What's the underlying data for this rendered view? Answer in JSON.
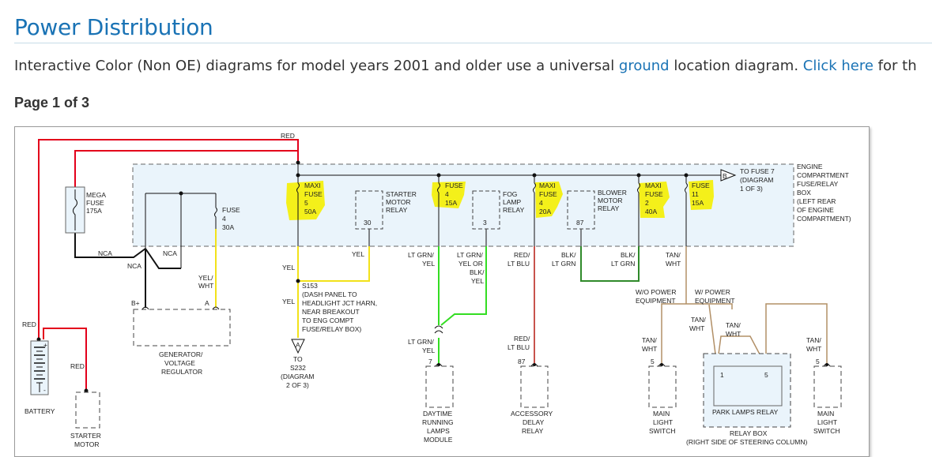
{
  "page": {
    "title": "Power Distribution",
    "intro_before": "Interactive Color (Non OE) diagrams for model years 2001 and older use a universal ",
    "intro_link_ground": "ground",
    "intro_middle": " location diagram. ",
    "intro_link_click": "Click here",
    "intro_after": " for th",
    "page_indicator": "Page 1 of 3"
  },
  "diagram": {
    "wire_labels": {
      "red_top": "RED",
      "red_battery": "RED",
      "red_starter": "RED",
      "nca1": "NCA",
      "nca2": "NCA",
      "nca3": "NCA",
      "yel_main": "YEL",
      "yel_relay": "YEL",
      "yel_splice": "YEL",
      "yel_wht": [
        "YEL/",
        "WHT"
      ],
      "lt_grn_yel": [
        "LT GRN/",
        "YEL"
      ],
      "lt_grn_yel_or": [
        "LT GRN/",
        "YEL OR",
        "BLK/",
        "YEL"
      ],
      "red_lt_blu": [
        "RED/",
        "LT BLU"
      ],
      "blk_lt_grn_1": [
        "BLK/",
        "LT GRN"
      ],
      "blk_lt_grn_2": [
        "BLK/",
        "LT GRN"
      ],
      "tan_wht_top": [
        "TAN/",
        "WHT"
      ],
      "lt_grn_yel_lower": [
        "LT GRN/",
        "YEL"
      ],
      "red_lt_blu_lower": [
        "RED/",
        "LT BLU"
      ],
      "tan_wht_switch_left": [
        "TAN/",
        "WHT"
      ],
      "tan_wht_relay_a": [
        "TAN/",
        "WHT"
      ],
      "tan_wht_relay_b": [
        "TAN/",
        "WHT"
      ],
      "tan_wht_switch_right": [
        "TAN/",
        "WHT"
      ]
    },
    "fuses": {
      "mega": [
        "MEGA",
        "FUSE",
        "175A"
      ],
      "fuse_4_30a": [
        "FUSE",
        "4",
        "30A"
      ],
      "maxi_5": [
        "MAXI",
        "FUSE",
        "5",
        "50A"
      ],
      "fuse_4_15a": [
        "FUSE",
        "4",
        "15A"
      ],
      "maxi_4": [
        "MAXI",
        "FUSE",
        "4",
        "20A"
      ],
      "maxi_2": [
        "MAXI",
        "FUSE",
        "2",
        "40A"
      ],
      "fuse_11": [
        "FUSE",
        "11",
        "15A"
      ]
    },
    "relays": {
      "starter": [
        "STARTER",
        "MOTOR",
        "RELAY"
      ],
      "fog": [
        "FOG",
        "LAMP",
        "RELAY"
      ],
      "blower": [
        "BLOWER",
        "MOTOR",
        "RELAY"
      ]
    },
    "pins": {
      "starter": "30",
      "fog": "3",
      "blower": "87",
      "b_plus": "B+",
      "gen_a": "A",
      "drl": "7",
      "acc": "87",
      "switch_left": "5",
      "relay_1": "1",
      "relay_5": "5",
      "switch_right": "5",
      "batt_plus": "+",
      "batt_minus": "-"
    },
    "connector_b": "B",
    "connector_a": "A",
    "to_fuse": [
      "TO FUSE 7",
      "(DIAGRAM",
      "1 OF 3)"
    ],
    "engine_box": [
      "ENGINE",
      "COMPARTMENT",
      "FUSE/RELAY",
      "BOX",
      "(LEFT REAR",
      "OF ENGINE",
      "COMPARTMENT)"
    ],
    "splice": [
      "S153",
      "(DASH PANEL TO",
      "HEADLIGHT JCT HARN,",
      "NEAR BREAKOUT",
      "TO ENG COMPT",
      "FUSE/RELAY BOX)"
    ],
    "to_s232": [
      "TO",
      "S232",
      "(DIAGRAM",
      "2 OF 3)"
    ],
    "equipment_wo": [
      "W/O POWER",
      "EQUIPMENT"
    ],
    "equipment_w": [
      "W/ POWER",
      "EQUIPMENT"
    ],
    "components": {
      "generator": [
        "GENERATOR/",
        "VOLTAGE",
        "REGULATOR"
      ],
      "battery": "BATTERY",
      "starter_motor": [
        "STARTER",
        "MOTOR"
      ],
      "drl": [
        "DAYTIME",
        "RUNNING",
        "LAMPS",
        "MODULE"
      ],
      "accessory": [
        "ACCESSORY",
        "DELAY",
        "RELAY"
      ],
      "main_switch_left": [
        "MAIN",
        "LIGHT",
        "SWITCH"
      ],
      "park_relay": "PARK LAMPS RELAY",
      "relay_box": [
        "RELAY BOX",
        "(RIGHT SIDE OF STEERING COLUMN)"
      ],
      "main_switch_right": [
        "MAIN",
        "LIGHT",
        "SWITCH"
      ]
    },
    "colors": {
      "red": "#e3001b",
      "black": "#111111",
      "yellow": "#f2e21a",
      "green": "#33dd22",
      "dark_red": "#b51a12",
      "dark_green": "#2f8a2a",
      "tan": "#b29067",
      "box_fill": "#eaf4fb",
      "highlight": "#f4f01a"
    }
  }
}
